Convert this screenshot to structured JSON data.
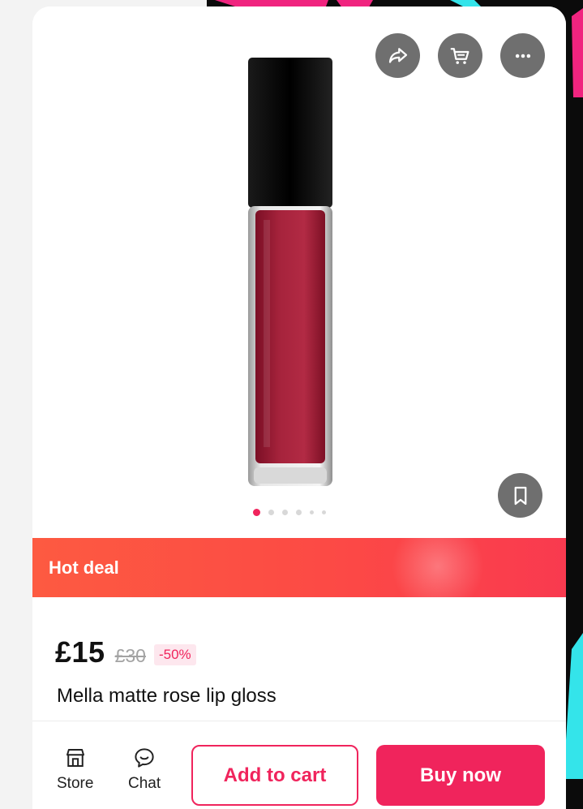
{
  "colors": {
    "accent": "#f0245c",
    "deal_start": "#fd5a41",
    "deal_end": "#f93a4f",
    "icon_bg": "#6f6f6f"
  },
  "gallery": {
    "actions": [
      {
        "name": "share",
        "icon": "share-icon"
      },
      {
        "name": "cart",
        "icon": "cart-icon"
      },
      {
        "name": "more",
        "icon": "more-icon"
      }
    ],
    "bookmark_icon": "bookmark-icon",
    "product_image": "lip-gloss-tube",
    "image_count": 6,
    "active_index": 0
  },
  "deal": {
    "label": "Hot deal"
  },
  "product": {
    "price": "£15",
    "original_price": "£30",
    "discount": "-50%",
    "title": "Mella matte rose lip gloss"
  },
  "bottom_bar": {
    "store_label": "Store",
    "chat_label": "Chat",
    "add_to_cart": "Add to cart",
    "buy_now": "Buy now"
  }
}
